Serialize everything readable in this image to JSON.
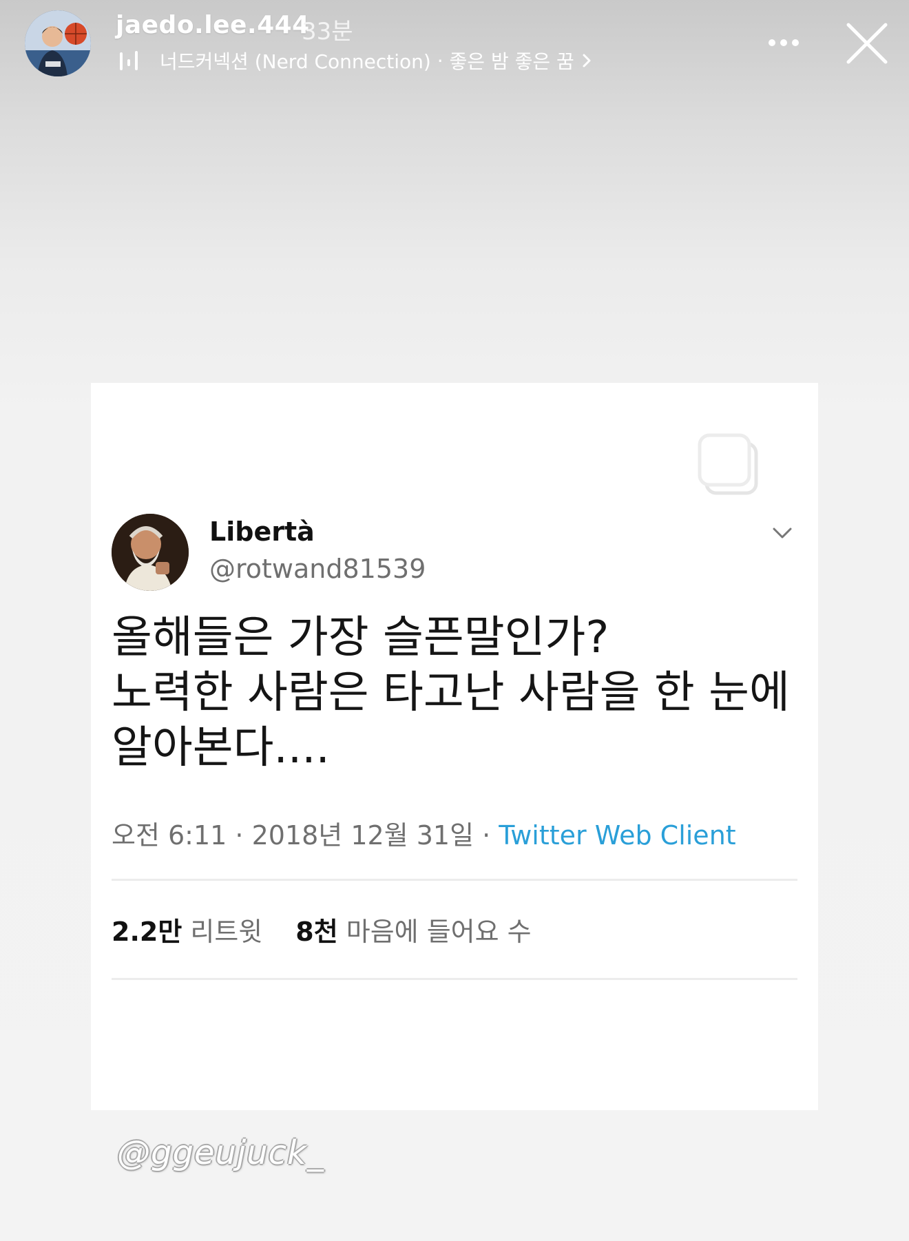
{
  "story": {
    "username": "jaedo.lee.444",
    "posted_ago": "33분",
    "music": {
      "artist": "너드커넥션 (Nerd Connection)",
      "separator": " · ",
      "title": "좋은 밤 좋은 꿈"
    },
    "icons": {
      "more": "more-dots-icon",
      "close": "close-icon",
      "music": "music-bars-icon"
    }
  },
  "tweet": {
    "display_name": "Libertà",
    "handle": "@rotwand81539",
    "text_lines": [
      "올해들은 가장 슬픈말인가?",
      "노력한 사람은 타고난 사람을 한 눈에",
      "알아본다...."
    ],
    "time": "오전 6:11",
    "date": "2018년 12월 31일",
    "meta_sep": " · ",
    "source": "Twitter Web Client",
    "retweets": {
      "count": "2.2만",
      "label": "리트윗"
    },
    "likes": {
      "count": "8천",
      "label": "마음에 들어요 수"
    },
    "colors": {
      "source_link": "#2a9fd8",
      "text": "#151515",
      "muted": "#6f6f6f"
    }
  },
  "watermark": "@ggeujuck_"
}
